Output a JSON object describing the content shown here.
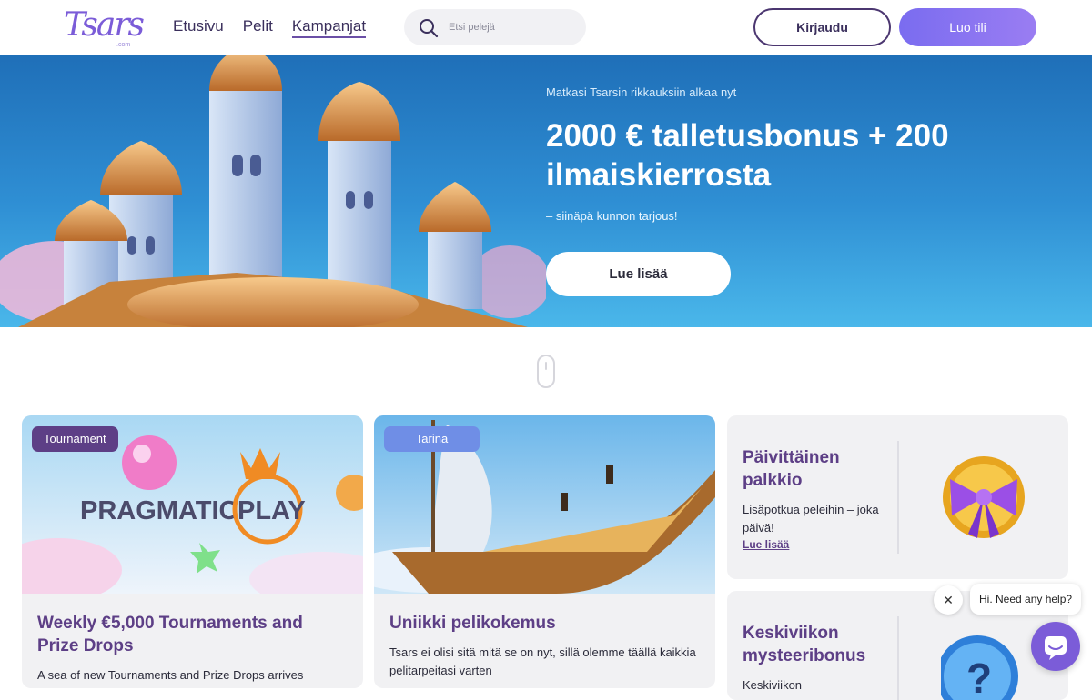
{
  "header": {
    "logo_text": "Tsars",
    "logo_sub": ".com",
    "nav": [
      {
        "label": "Etusivu"
      },
      {
        "label": "Pelit"
      },
      {
        "label": "Kampanjat"
      }
    ],
    "search_placeholder": "Etsi pelejä",
    "login_label": "Kirjaudu",
    "signup_label": "Luo tili"
  },
  "hero": {
    "subtitle": "Matkasi Tsarsin rikkauksiin alkaa nyt",
    "title": "2000 € talletusbonus + 200 ilmaiskierrosta",
    "tagline": "– siinäpä kunnon tarjous!",
    "cta_label": "Lue lisää"
  },
  "cards": [
    {
      "badge": "Tournament",
      "image_brand": "PRAGMATIC PLAY",
      "title": "Weekly €5,000 Tournaments and Prize Drops",
      "description": "A sea of new Tournaments and Prize Drops arrives"
    },
    {
      "badge": "Tarina",
      "title": "Uniikki pelikokemus",
      "description": "Tsars ei olisi sitä mitä se on nyt, sillä olemme täällä kaikkia pelitarpeitasi varten"
    }
  ],
  "promos": [
    {
      "title": "Päivittäinen palkkio",
      "description": "Lisäpotkua peleihin – joka päivä!",
      "link": "Lue lisää"
    },
    {
      "title": "Keskiviikon mysteeribonus",
      "description": "Keskiviikon"
    }
  ],
  "chat": {
    "greeting": "Hi. Need any help?"
  },
  "colors": {
    "brand_purple": "#5d3f86",
    "accent_violet": "#7b5cd8",
    "hero_blue": "#2f8fd4"
  }
}
